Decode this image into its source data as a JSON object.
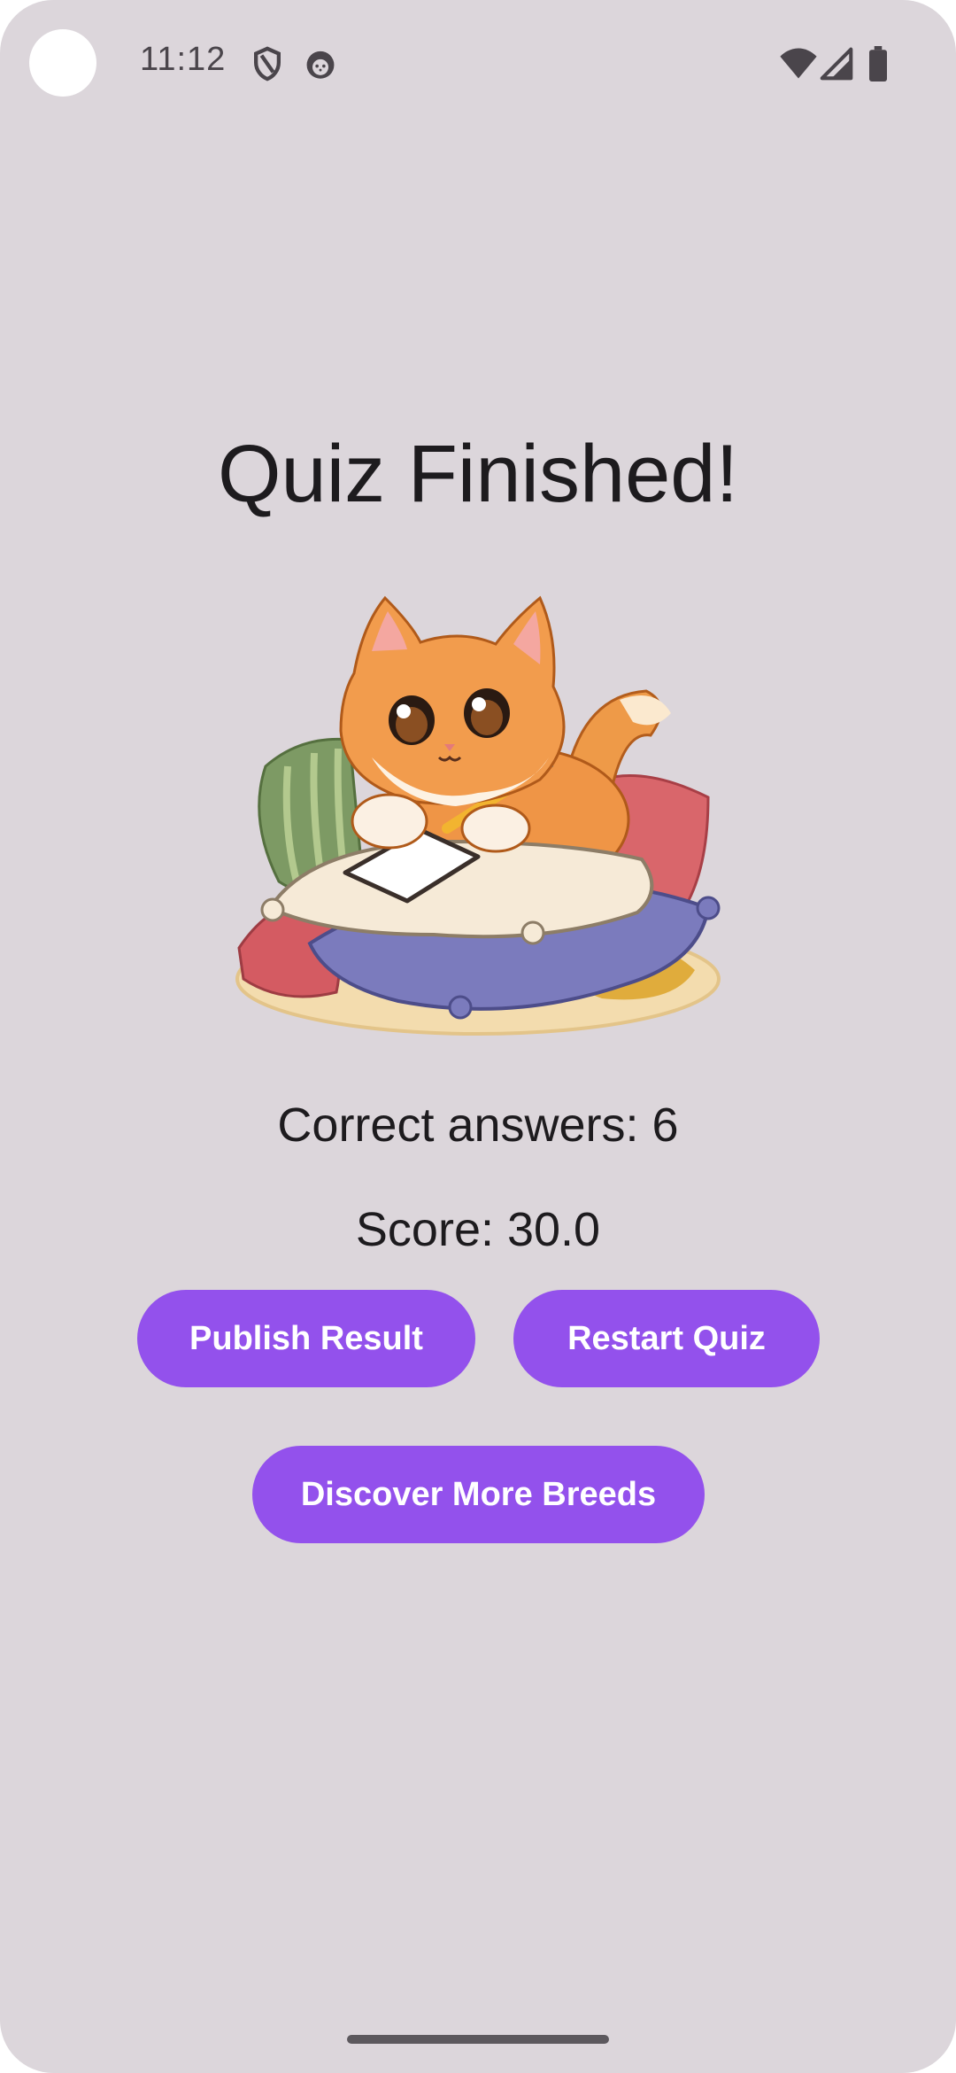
{
  "status_bar": {
    "time": "11:12",
    "icons": [
      "shield-icon",
      "cat-face-icon",
      "wifi-icon",
      "signal-icon",
      "battery-icon"
    ]
  },
  "quiz_result": {
    "title": "Quiz Finished!",
    "correct_answers_text": "Correct answers: 6",
    "score_text": "Score: 30.0",
    "illustration": "cat-writing-on-pillows-illustration"
  },
  "actions": {
    "publish_label": "Publish Result",
    "restart_label": "Restart Quiz",
    "discover_label": "Discover More Breeds"
  },
  "colors": {
    "background": "#dcd6db",
    "button": "#9351ec",
    "button_text": "#ffffff",
    "text": "#1d1b1e"
  }
}
